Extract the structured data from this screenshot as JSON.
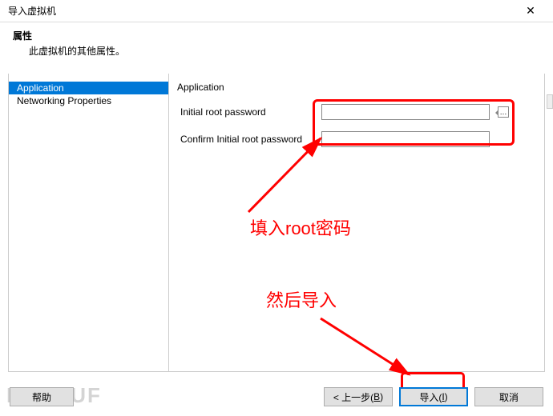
{
  "window": {
    "title": "导入虚拟机",
    "close_glyph": "✕"
  },
  "header": {
    "label": "属性",
    "desc": "此虚拟机的其他属性。"
  },
  "sidebar": {
    "items": [
      {
        "label": "Application",
        "selected": true
      },
      {
        "label": "Networking Properties",
        "selected": false
      }
    ]
  },
  "form": {
    "section_title": "Application",
    "rows": [
      {
        "label": "Initial root password",
        "value": ""
      },
      {
        "label": "Confirm Initial root password",
        "value": ""
      }
    ],
    "hint_glyph": "…"
  },
  "annotations": {
    "fill_password": "填入root密码",
    "then_import": "然后导入"
  },
  "buttons": {
    "help": "帮助",
    "back_prefix": "< 上一步(",
    "back_key": "B",
    "back_suffix": ")",
    "import_prefix": "导入(",
    "import_key": "I",
    "import_suffix": ")",
    "cancel": "取消"
  },
  "watermark": "REEBUF"
}
